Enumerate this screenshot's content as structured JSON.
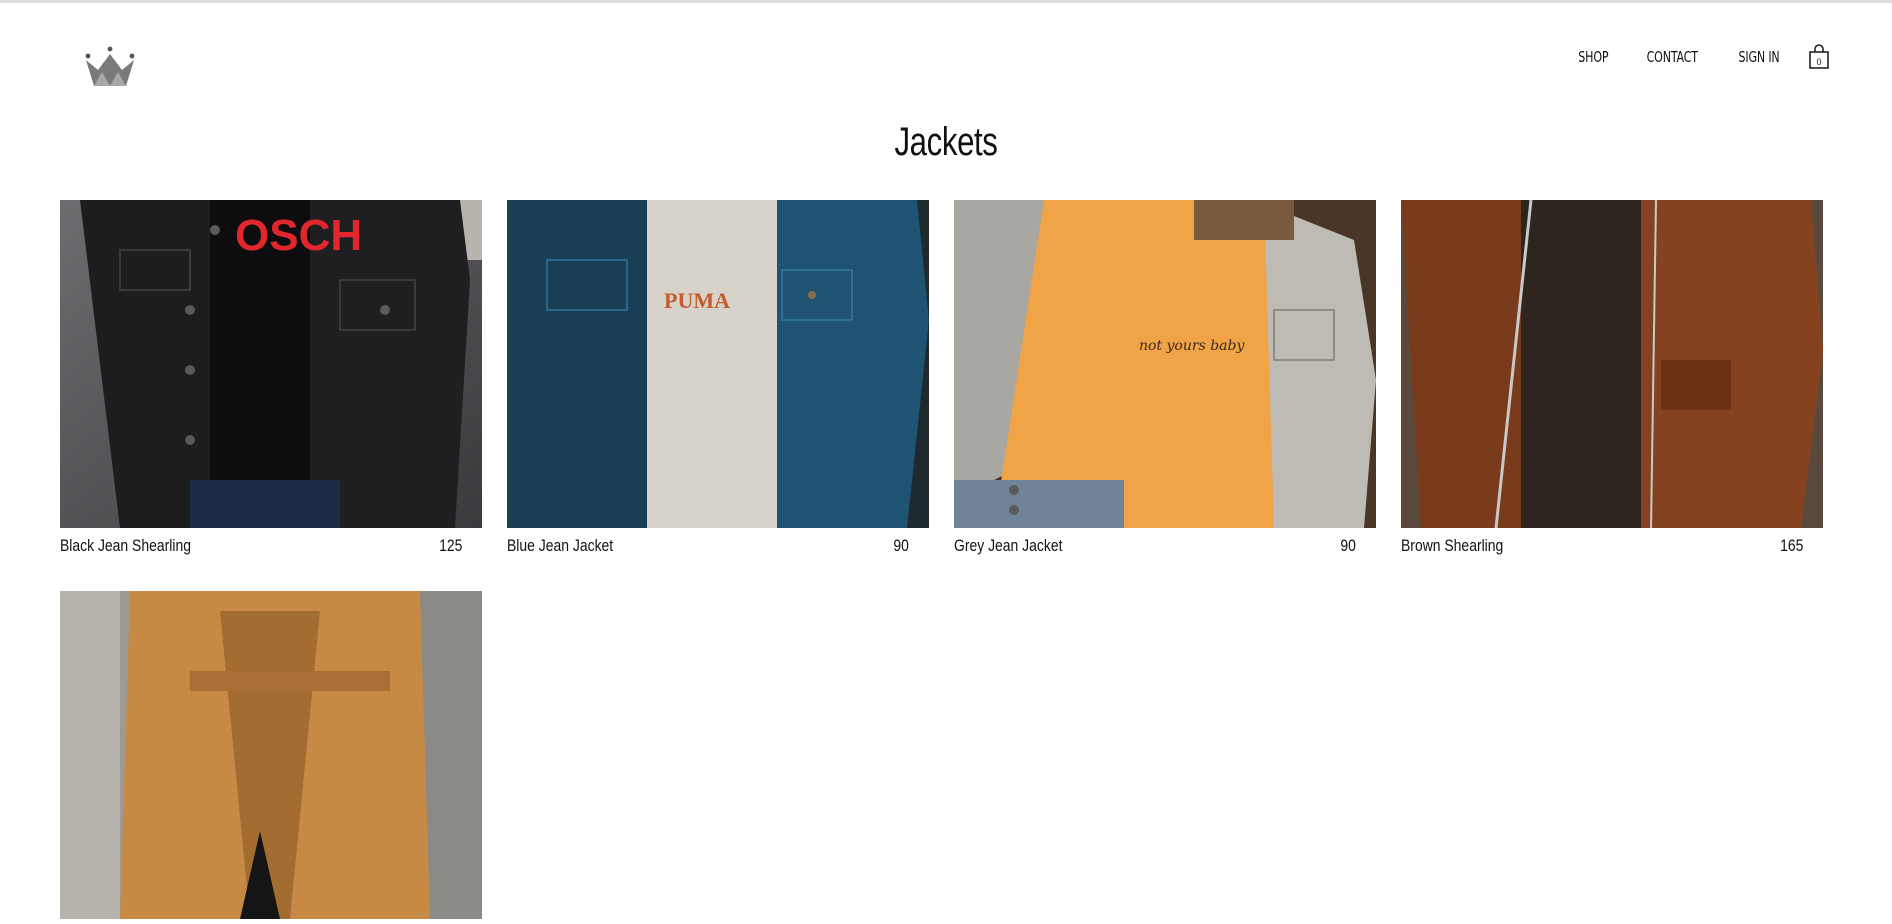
{
  "header": {
    "logo_icon": "crown-icon",
    "nav": [
      {
        "label": "SHOP"
      },
      {
        "label": "CONTACT"
      },
      {
        "label": "SIGN IN"
      }
    ],
    "cart_icon": "shopping-bag-icon"
  },
  "page": {
    "title": "Jackets"
  },
  "products": [
    {
      "name": "Black Jean Shearling",
      "price": "125",
      "image": "black denim jacket over black tee with red print"
    },
    {
      "name": "Blue Jean Jacket",
      "price": "90",
      "image": "blue denim jacket over white PUMA tee"
    },
    {
      "name": "Grey Jean Jacket",
      "price": "90",
      "image": "grey denim jacket over orange tee"
    },
    {
      "name": "Brown Shearling",
      "price": "165",
      "image": "brown suede zip jacket"
    },
    {
      "name": "",
      "price": "",
      "image": "camel wrap coat with belt"
    }
  ]
}
